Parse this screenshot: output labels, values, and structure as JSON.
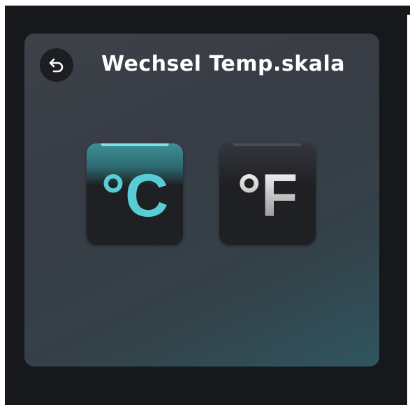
{
  "header": {
    "title": "Wechsel Temp.skala",
    "back_icon": "undo-arrow-icon"
  },
  "units": {
    "celsius": {
      "label": "°C",
      "selected": true,
      "color": "#58cdd6"
    },
    "fahrenheit": {
      "label": "°F",
      "selected": false,
      "color": "#c9c9c9"
    }
  },
  "colors": {
    "screen_background": "#17181c",
    "panel_accent": "#2f5560",
    "active_accent": "#58cdd6"
  }
}
